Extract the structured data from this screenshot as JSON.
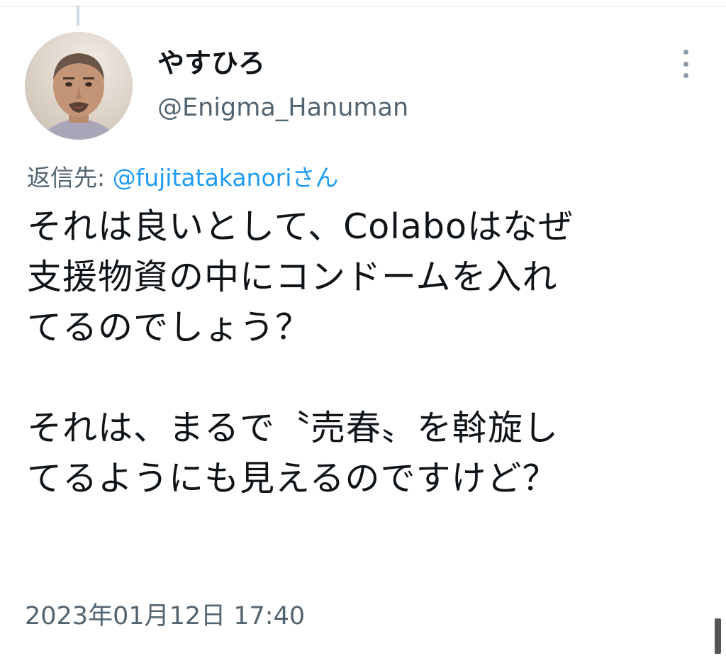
{
  "tweet": {
    "display_name": "やすひろ",
    "handle": "@Enigma_Hanuman",
    "reply_to_prefix": "返信先: ",
    "reply_to_user": "@fujitatakanoriさん",
    "body_lines": [
      "それは良いとして、Colaboはなぜ",
      "支援物資の中にコンドームを入れ",
      "てるのでしょう？",
      "",
      "それは、まるで〝売春〟を斡旋し",
      "てるようにも見えるのですけど？"
    ],
    "timestamp": "2023年01月12日 17:40"
  },
  "icons": {
    "more": "more-vertical-icon",
    "avatar": "profile-photo"
  },
  "colors": {
    "text": "#0f1419",
    "secondary": "#536471",
    "link": "#1d9bf0"
  }
}
